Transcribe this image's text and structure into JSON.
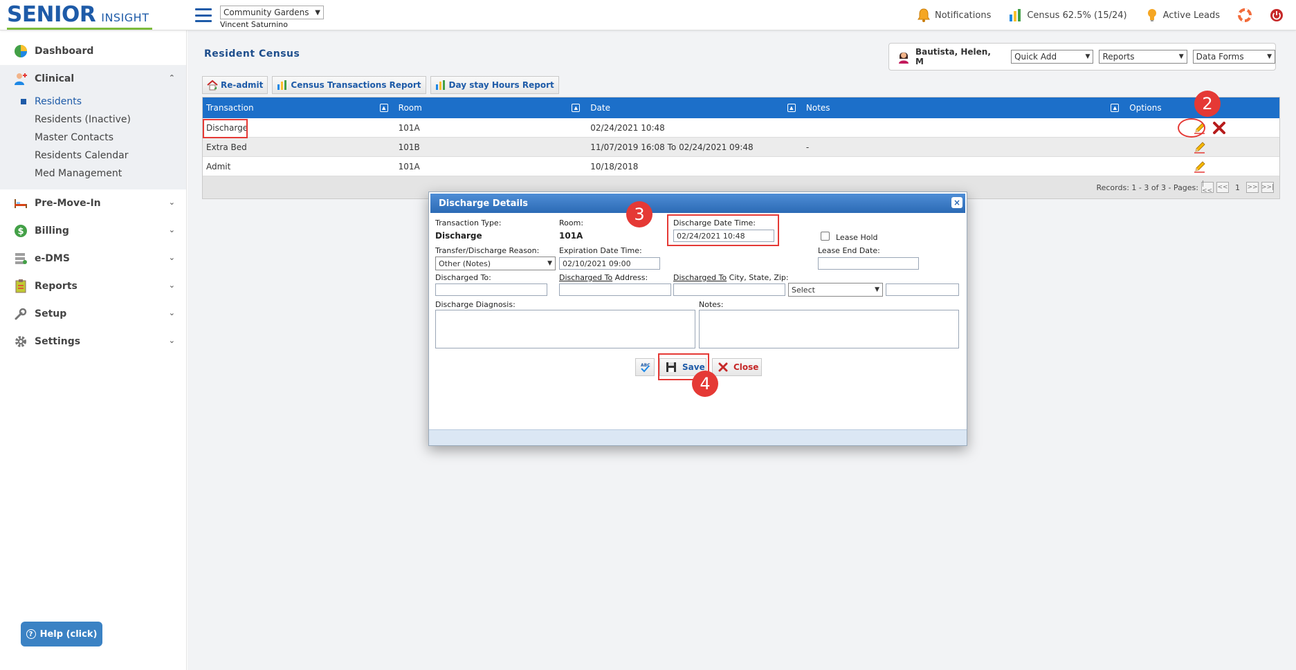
{
  "app": {
    "logo_main": "SENIOR",
    "logo_sub": "INSIGHT"
  },
  "header": {
    "community": "Community Gardens",
    "user": "Vincent Saturnino",
    "notifications": "Notifications",
    "census": "Census 62.5% (15/24)",
    "active_leads": "Active Leads"
  },
  "sidebar": {
    "dashboard": "Dashboard",
    "clinical": "Clinical",
    "clinical_items": [
      "Residents",
      "Residents (Inactive)",
      "Master Contacts",
      "Residents Calendar",
      "Med Management"
    ],
    "pre_move_in": "Pre-Move-In",
    "billing": "Billing",
    "edms": "e-DMS",
    "reports": "Reports",
    "setup": "Setup",
    "settings": "Settings",
    "help": "Help (click)"
  },
  "page": {
    "title": "Resident Census",
    "resident": "Bautista, Helen, M",
    "quick_add": "Quick Add",
    "reports": "Reports",
    "data_forms": "Data Forms"
  },
  "toolbar": {
    "readmit": "Re-admit",
    "census_report": "Census Transactions Report",
    "daystay_report": "Day stay Hours Report"
  },
  "grid": {
    "columns": [
      "Transaction",
      "Room",
      "Date",
      "Notes",
      "Options"
    ],
    "rows": [
      {
        "transaction": "Discharge",
        "room": "101A",
        "date": "02/24/2021 10:48",
        "notes": ""
      },
      {
        "transaction": "Extra Bed",
        "room": "101B",
        "date": "11/07/2019 16:08 To 02/24/2021 09:48",
        "notes": "-"
      },
      {
        "transaction": "Admit",
        "room": "101A",
        "date": "10/18/2018",
        "notes": ""
      }
    ],
    "footer": "Records: 1 - 3 of 3 - Pages:",
    "page": "1"
  },
  "annotations": {
    "a2": "2",
    "a3": "3",
    "a4": "4"
  },
  "modal": {
    "title": "Discharge Details",
    "transaction_type_label": "Transaction Type:",
    "transaction_type": "Discharge",
    "room_label": "Room:",
    "room": "101A",
    "discharge_dt_label": "Discharge Date Time:",
    "discharge_dt": "02/24/2021 10:48",
    "lease_hold": "Lease Hold",
    "reason_label": "Transfer/Discharge Reason:",
    "reason": "Other (Notes)",
    "expiration_label": "Expiration Date Time:",
    "expiration": "02/10/2021 09:00",
    "lease_end_label": "Lease End Date:",
    "discharged_to_label": "Discharged To:",
    "addr_label_u": "Discharged To",
    "addr_label_rest": " Address:",
    "city_label_u": "Discharged To",
    "city_label_rest": " City, State, Zip:",
    "state_select": "Select",
    "diagnosis_label": "Discharge Diagnosis:",
    "notes_label": "Notes:",
    "save": "Save",
    "close": "Close"
  },
  "colors": {
    "brand": "#1e5ba8",
    "header_blue": "#1c6fc9",
    "annotation": "#e53935"
  }
}
